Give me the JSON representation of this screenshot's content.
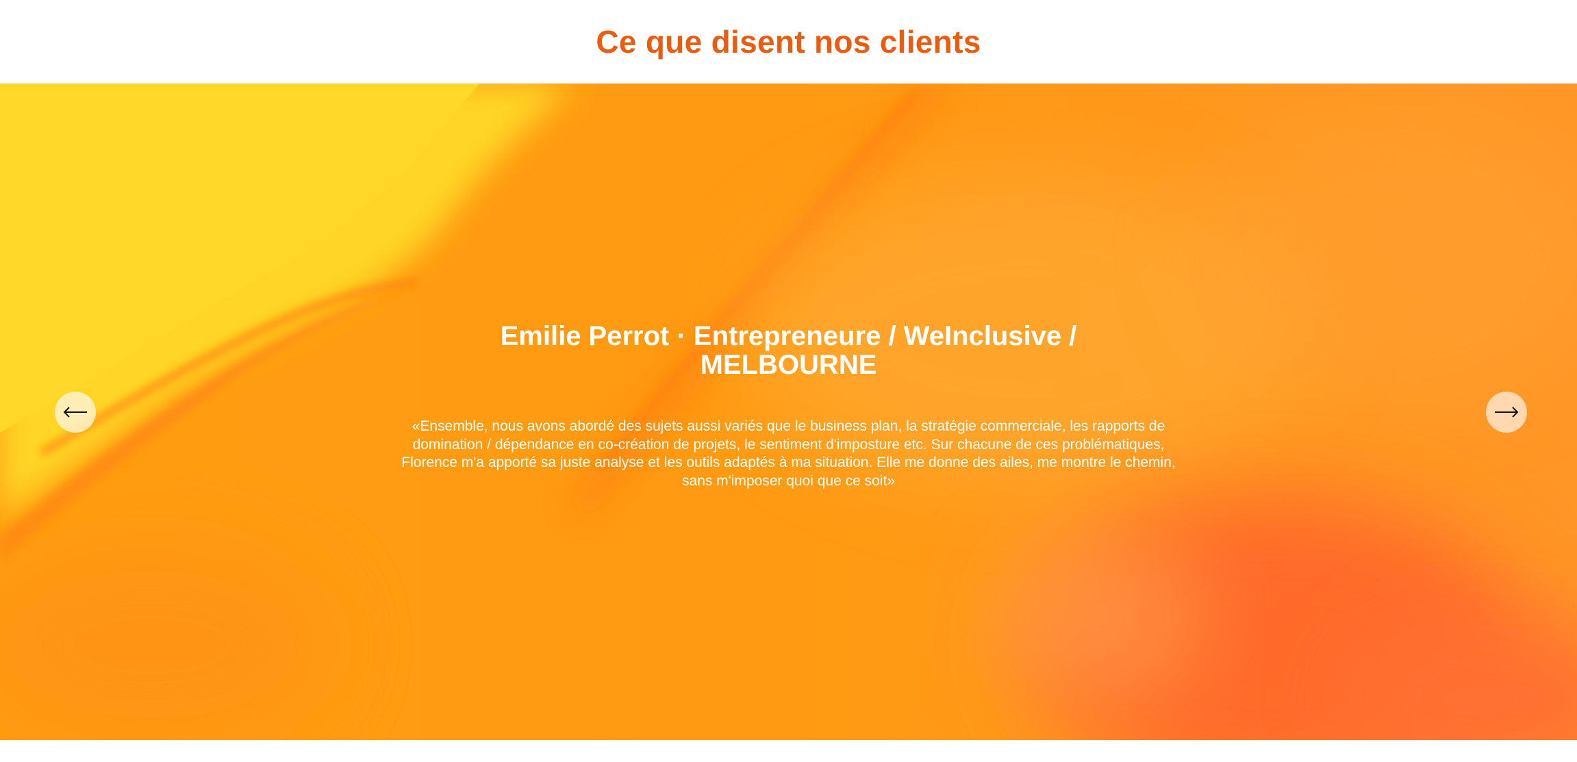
{
  "section": {
    "title": "Ce que disent nos clients"
  },
  "testimonial": {
    "author": "Emilie Perrot · Entrepreneure / WeInclusive / MELBOURNE",
    "quote": "«Ensemble, nous avons abordé des sujets aussi variés que le business plan, la stratégie commerciale, les rapports de domination / dépendance en co-création de projets, le sentiment d'imposture etc. Sur chacune de ces problématiques, Florence m'a apporté sa juste analyse et les outils adaptés à ma situation. Elle me donne des ailes, me montre le chemin, sans m'imposer quoi que ce soit»"
  },
  "controls": {
    "prev_icon": "arrow-left-icon",
    "next_icon": "arrow-right-icon"
  },
  "colors": {
    "title": "#e85d12",
    "slide_text": "#ffffff",
    "background_yellow": "#ffd627",
    "background_orange": "#ff9b12",
    "background_red_orange": "#ff6a2c"
  }
}
